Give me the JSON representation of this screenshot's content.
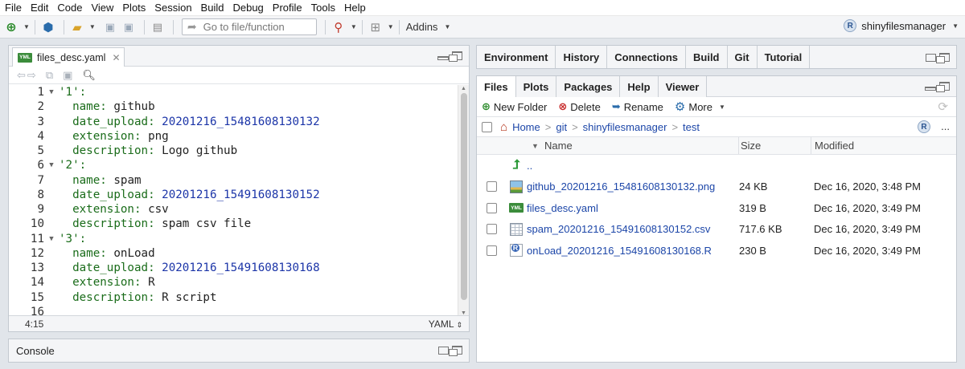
{
  "menu": [
    "File",
    "Edit",
    "Code",
    "View",
    "Plots",
    "Session",
    "Build",
    "Debug",
    "Profile",
    "Tools",
    "Help"
  ],
  "toolbar": {
    "goto_placeholder": "Go to file/function",
    "addins_label": "Addins",
    "project_name": "shinyfilesmanager"
  },
  "editor": {
    "tab_label": "files_desc.yaml",
    "cursor_pos": "4:15",
    "mode": "YAML",
    "lines": [
      {
        "n": "1",
        "fold": "▼",
        "key": "'1'",
        "sep": ":",
        "val": "",
        "indent": ""
      },
      {
        "n": "2",
        "fold": "",
        "key": "name",
        "sep": ": ",
        "val": "github",
        "indent": "  ",
        "valtype": "plain"
      },
      {
        "n": "3",
        "fold": "",
        "key": "date_upload",
        "sep": ": ",
        "val": "20201216_15481608130132",
        "indent": "  ",
        "valtype": "num"
      },
      {
        "n": "4",
        "fold": "",
        "key": "extension",
        "sep": ": ",
        "val": "png",
        "indent": "  ",
        "valtype": "plain"
      },
      {
        "n": "5",
        "fold": "",
        "key": "description",
        "sep": ": ",
        "val": "Logo github",
        "indent": "  ",
        "valtype": "plain"
      },
      {
        "n": "6",
        "fold": "▼",
        "key": "'2'",
        "sep": ":",
        "val": "",
        "indent": ""
      },
      {
        "n": "7",
        "fold": "",
        "key": "name",
        "sep": ": ",
        "val": "spam",
        "indent": "  ",
        "valtype": "plain"
      },
      {
        "n": "8",
        "fold": "",
        "key": "date_upload",
        "sep": ": ",
        "val": "20201216_15491608130152",
        "indent": "  ",
        "valtype": "num"
      },
      {
        "n": "9",
        "fold": "",
        "key": "extension",
        "sep": ": ",
        "val": "csv",
        "indent": "  ",
        "valtype": "plain"
      },
      {
        "n": "10",
        "fold": "",
        "key": "description",
        "sep": ": ",
        "val": "spam csv file",
        "indent": "  ",
        "valtype": "plain"
      },
      {
        "n": "11",
        "fold": "▼",
        "key": "'3'",
        "sep": ":",
        "val": "",
        "indent": ""
      },
      {
        "n": "12",
        "fold": "",
        "key": "name",
        "sep": ": ",
        "val": "onLoad",
        "indent": "  ",
        "valtype": "plain"
      },
      {
        "n": "13",
        "fold": "",
        "key": "date_upload",
        "sep": ": ",
        "val": "20201216_15491608130168",
        "indent": "  ",
        "valtype": "num"
      },
      {
        "n": "14",
        "fold": "",
        "key": "extension",
        "sep": ": ",
        "val": "R",
        "indent": "  ",
        "valtype": "plain"
      },
      {
        "n": "15",
        "fold": "",
        "key": "description",
        "sep": ": ",
        "val": "R script",
        "indent": "  ",
        "valtype": "plain"
      },
      {
        "n": "16",
        "fold": "",
        "key": "",
        "sep": "",
        "val": "",
        "indent": ""
      }
    ]
  },
  "console": {
    "label": "Console"
  },
  "env_tabs": [
    "Environment",
    "History",
    "Connections",
    "Build",
    "Git",
    "Tutorial"
  ],
  "files_tabs": [
    "Files",
    "Plots",
    "Packages",
    "Help",
    "Viewer"
  ],
  "files_toolbar": {
    "new_folder": "New Folder",
    "delete": "Delete",
    "rename": "Rename",
    "more": "More"
  },
  "breadcrumb": [
    "Home",
    "git",
    "shinyfilesmanager",
    "test"
  ],
  "ellipsis": "...",
  "columns": {
    "name": "Name",
    "size": "Size",
    "modified": "Modified"
  },
  "parent_dir": "..",
  "files": [
    {
      "name": "github_20201216_15481608130132.png",
      "size": "24 KB",
      "modified": "Dec 16, 2020, 3:48 PM",
      "icon": "image-file-icon"
    },
    {
      "name": "files_desc.yaml",
      "size": "319 B",
      "modified": "Dec 16, 2020, 3:49 PM",
      "icon": "yaml-file-icon"
    },
    {
      "name": "spam_20201216_15491608130152.csv",
      "size": "717.6 KB",
      "modified": "Dec 16, 2020, 3:49 PM",
      "icon": "csv-file-icon"
    },
    {
      "name": "onLoad_20201216_15491608130168.R",
      "size": "230 B",
      "modified": "Dec 16, 2020, 3:49 PM",
      "icon": "r-file-icon"
    }
  ],
  "colors": {
    "accent_link": "#1c46a8",
    "yaml_key": "#1a6c1a",
    "yaml_number": "#1c35a8",
    "pane_border": "#c3c9d0"
  }
}
